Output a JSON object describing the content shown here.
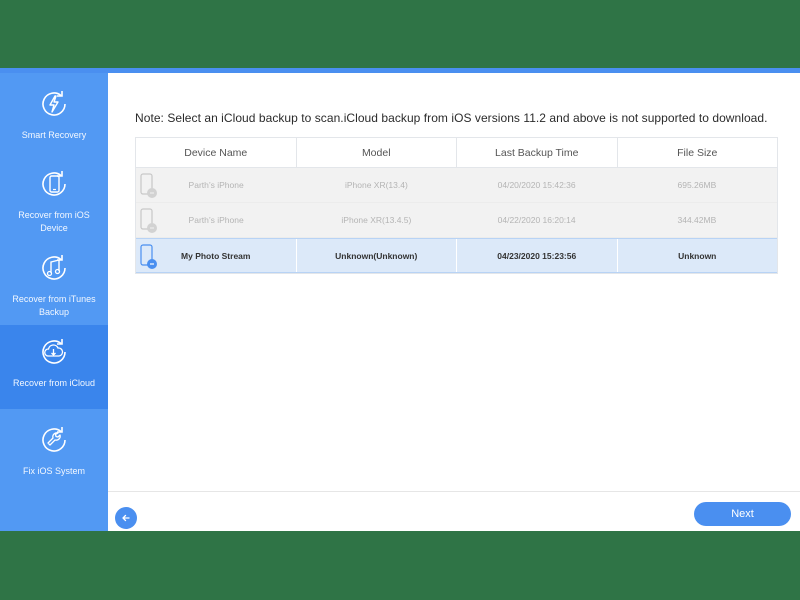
{
  "colors": {
    "frame_green": "#2f7446",
    "accent_blue": "#4a8ff0",
    "sidebar_blue": "#5299f3",
    "sidebar_active": "#3a85ec",
    "selected_row": "#dce9f9"
  },
  "sidebar": {
    "items": [
      {
        "label": "Smart Recovery",
        "icon": "lightning-refresh-icon",
        "active": false
      },
      {
        "label": "Recover from iOS Device",
        "icon": "phone-refresh-icon",
        "active": false
      },
      {
        "label": "Recover from iTunes Backup",
        "icon": "music-note-refresh-icon",
        "active": false
      },
      {
        "label": "Recover from iCloud",
        "icon": "cloud-download-refresh-icon",
        "active": true
      },
      {
        "label": "Fix iOS System",
        "icon": "wrench-refresh-icon",
        "active": false
      }
    ]
  },
  "main": {
    "note": "Note: Select an iCloud backup to scan.iCloud backup from iOS versions 11.2 and above is not supported to download.",
    "table": {
      "columns": [
        "Device Name",
        "Model",
        "Last Backup Time",
        "File Size"
      ],
      "rows": [
        {
          "device": "Parth’s iPhone",
          "model": "iPhone XR(13.4)",
          "time": "04/20/2020 15:42:36",
          "size": "695.26MB",
          "state": "disabled"
        },
        {
          "device": "Parth’s iPhone",
          "model": "iPhone XR(13.4.5)",
          "time": "04/22/2020 16:20:14",
          "size": "344.42MB",
          "state": "disabled"
        },
        {
          "device": "My Photo Stream",
          "model": "Unknown(Unknown)",
          "time": "04/23/2020 15:23:56",
          "size": "Unknown",
          "state": "selected"
        }
      ]
    }
  },
  "footer": {
    "back_icon": "arrow-left-icon",
    "next_label": "Next"
  }
}
